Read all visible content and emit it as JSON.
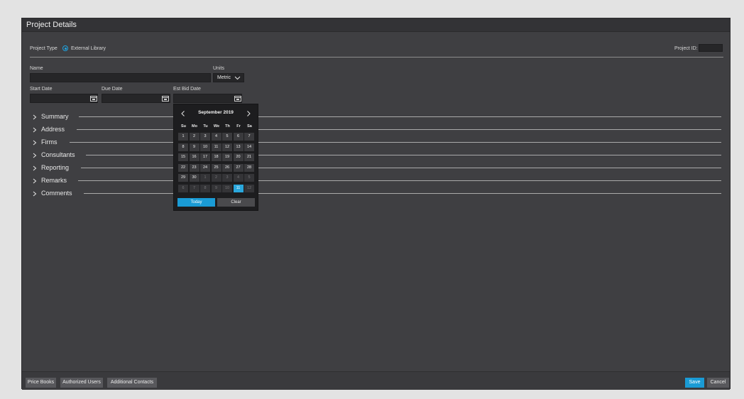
{
  "window": {
    "title": "Project Details"
  },
  "project_type": {
    "label": "Project Type",
    "option": "External Library",
    "selected": true
  },
  "project_id": {
    "label": "Project ID:",
    "value": ""
  },
  "name": {
    "label": "Name",
    "value": ""
  },
  "units": {
    "label": "Units",
    "value": "Metric"
  },
  "dates": {
    "start_label": "Start Date",
    "start_value": "",
    "due_label": "Due Date",
    "due_value": "",
    "bid_label": "Est Bid Date",
    "bid_value": ""
  },
  "sections": [
    "Summary",
    "Address",
    "Firms",
    "Consultants",
    "Reporting",
    "Remarks",
    "Comments"
  ],
  "datepicker": {
    "month_label": "September 2019",
    "weekdays": [
      "Su",
      "Mo",
      "Tu",
      "We",
      "Th",
      "Fr",
      "Sa"
    ],
    "weeks": [
      [
        "1",
        "2",
        "3",
        "4",
        "5",
        "6",
        "7"
      ],
      [
        "8",
        "9",
        "10",
        "11",
        "12",
        "13",
        "14"
      ],
      [
        "15",
        "16",
        "17",
        "18",
        "19",
        "20",
        "21"
      ],
      [
        "22",
        "23",
        "24",
        "25",
        "26",
        "27",
        "28"
      ],
      [
        "29",
        "30",
        "1",
        "2",
        "3",
        "4",
        "5"
      ],
      [
        "6",
        "7",
        "8",
        "9",
        "10",
        "11",
        "12"
      ]
    ],
    "selected_day": "11",
    "today_label": "Today",
    "clear_label": "Clear"
  },
  "footer": {
    "left_buttons": [
      "Price Books",
      "Authorized Users",
      "Additional Contacts"
    ],
    "save_label": "Save",
    "cancel_label": "Cancel"
  },
  "colors": {
    "accent": "#1a9bd5",
    "panel": "#3f3f42",
    "field": "#262628"
  }
}
